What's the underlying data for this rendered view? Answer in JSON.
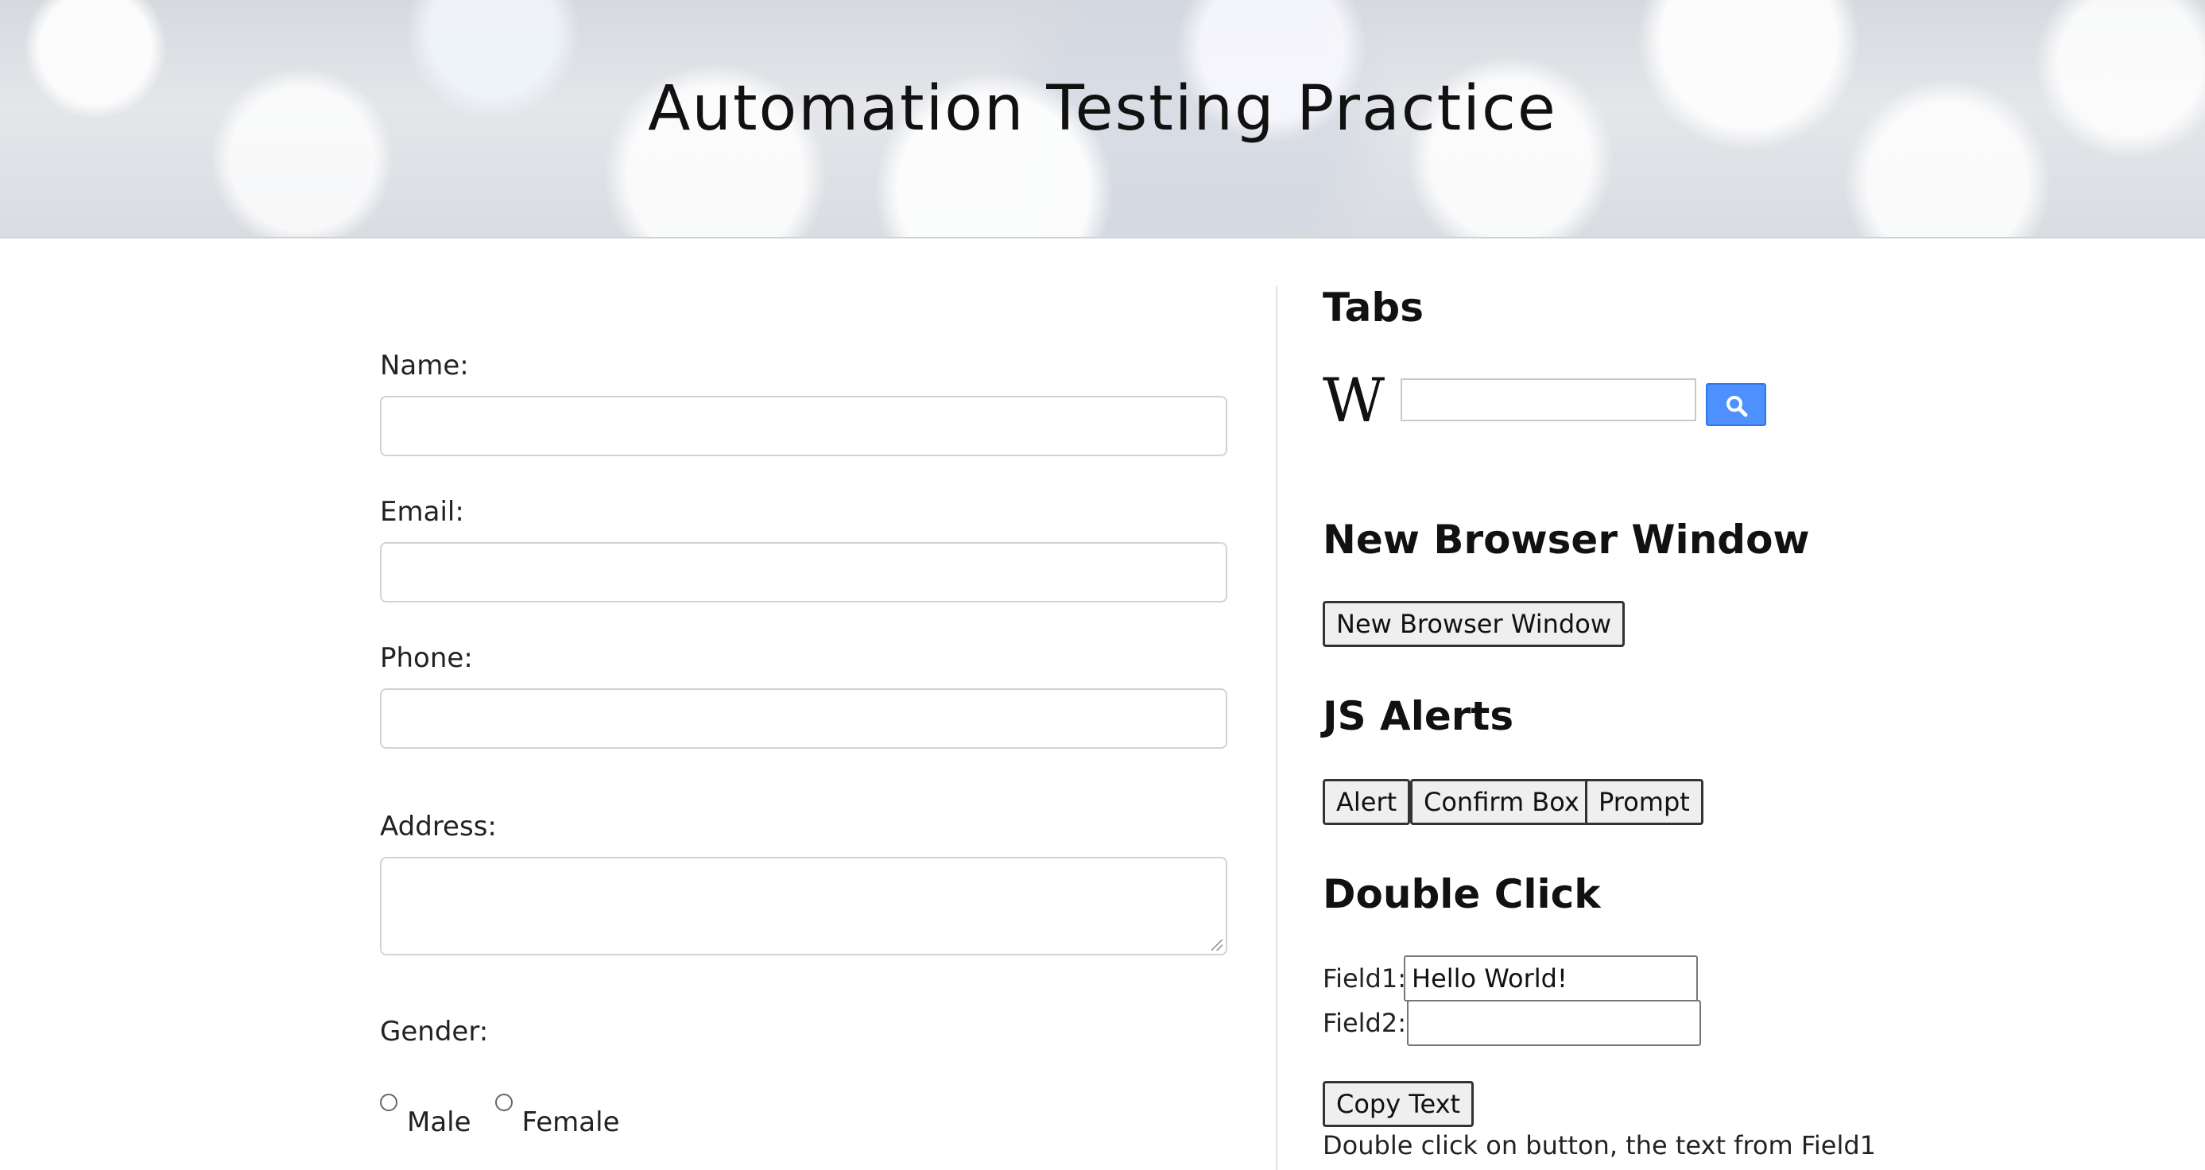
{
  "header": {
    "title": "Automation Testing Practice"
  },
  "form": {
    "name_label": "Name:",
    "name_value": "",
    "email_label": "Email:",
    "email_value": "",
    "phone_label": "Phone:",
    "phone_value": "",
    "address_label": "Address:",
    "address_value": "",
    "gender_label": "Gender:",
    "gender_options": [
      "Male",
      "Female"
    ]
  },
  "tabs": {
    "heading": "Tabs",
    "wiki_logo": "W",
    "search_value": "",
    "search_icon": "search-icon"
  },
  "new_window": {
    "heading": "New Browser Window",
    "button_label": "New Browser Window"
  },
  "alerts": {
    "heading": "JS Alerts",
    "alert_label": "Alert",
    "confirm_label": "Confirm Box",
    "prompt_label": "Prompt"
  },
  "double_click": {
    "heading": "Double Click",
    "field1_label": "Field1:",
    "field1_value": "Hello World!",
    "field2_label": "Field2:",
    "field2_value": "",
    "copy_button_label": "Copy Text",
    "help_text": "Double click on button, the text from Field1"
  },
  "colors": {
    "search_button": "#4d90fe",
    "button_bg": "#efefef"
  }
}
